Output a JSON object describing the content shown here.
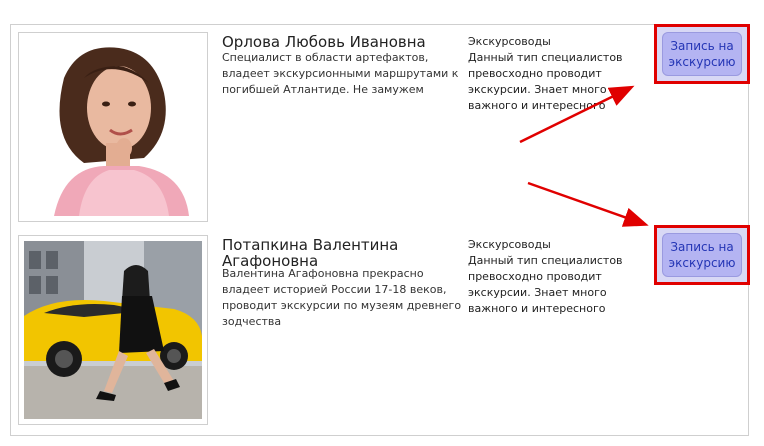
{
  "specialists": [
    {
      "name": "Орлова Любовь Ивановна",
      "description": "Специалист в области артефактов, владеет экскурсионными маршрутами к погибшей Атлантиде. Не замужем",
      "category_title": "Экскурсоводы",
      "category_description": "Данный тип специалистов превосходно проводит экскурсии. Знает много важного и интересного",
      "book_label": "Запись на экскурсию"
    },
    {
      "name": "Потапкина Валентина Агафоновна",
      "description": "Валентина Агафоновна прекрасно владеет историей России 17-18 веков, проводит экскурсии по музеям древнего зодчества",
      "category_title": "Экскурсоводы",
      "category_description": "Данный тип специалистов превосходно проводит экскурсии. Знает много важного и интересного",
      "book_label": "Запись на экскурсию"
    }
  ],
  "colors": {
    "highlight": "#e00000",
    "button_bg": "#b4b4f2",
    "button_text": "#2435b5"
  }
}
